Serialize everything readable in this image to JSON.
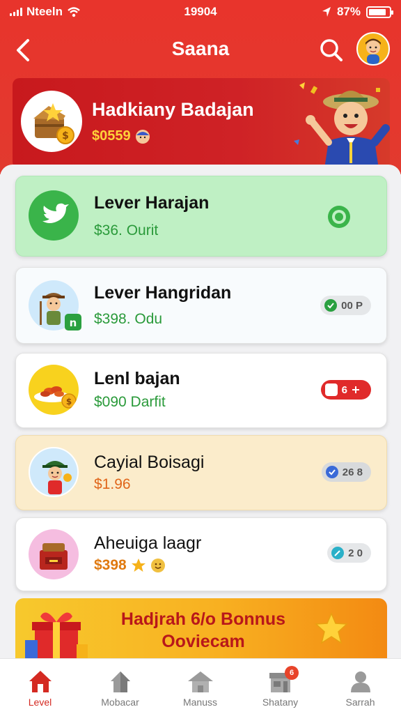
{
  "status_bar": {
    "carrier": "Nteeln",
    "time": "19904",
    "battery": "87%",
    "battery_level": 0.87
  },
  "header": {
    "title": "Saana"
  },
  "hero": {
    "title": "Hadkiany Badajan",
    "amount": "$0559"
  },
  "items": [
    {
      "title": "Lever Harajan",
      "subtitle": "$36. Ourit",
      "action": "",
      "bg": "#bff0c4",
      "sub_color": "#2a9a3a"
    },
    {
      "title": "Lever Hangridan",
      "subtitle": "$398. Odu",
      "action": "00 P",
      "bg": "#f8fbfd",
      "sub_color": "#2a9a3a"
    },
    {
      "title": "Lenl bajan",
      "subtitle": "$090 Darfit",
      "action": "6",
      "bg": "#ffffff",
      "sub_color": "#2a9a3a"
    },
    {
      "title": "Cayial Boisagi",
      "subtitle": "$1.96",
      "action": "26 8",
      "bg": "#fbeccb",
      "sub_color": "#e0651a"
    },
    {
      "title": "Aheuiga laagr",
      "subtitle": "$398",
      "action": "2 0",
      "bg": "#ffffff",
      "sub_color": "#e07a10"
    }
  ],
  "bonus": {
    "line1": "Hadjrah 6/o Bonnus",
    "line2": "Ooviecam"
  },
  "nav": [
    {
      "label": "Level",
      "active": true
    },
    {
      "label": "Mobacar",
      "active": false
    },
    {
      "label": "Manuss",
      "active": false
    },
    {
      "label": "Shatany",
      "active": false,
      "badge": "6"
    },
    {
      "label": "Sarrah",
      "active": false
    }
  ],
  "colors": {
    "primary_red": "#e8342c",
    "hero_red": "#c8191d",
    "accent_yellow": "#ffd23a",
    "green": "#3ab44a"
  }
}
